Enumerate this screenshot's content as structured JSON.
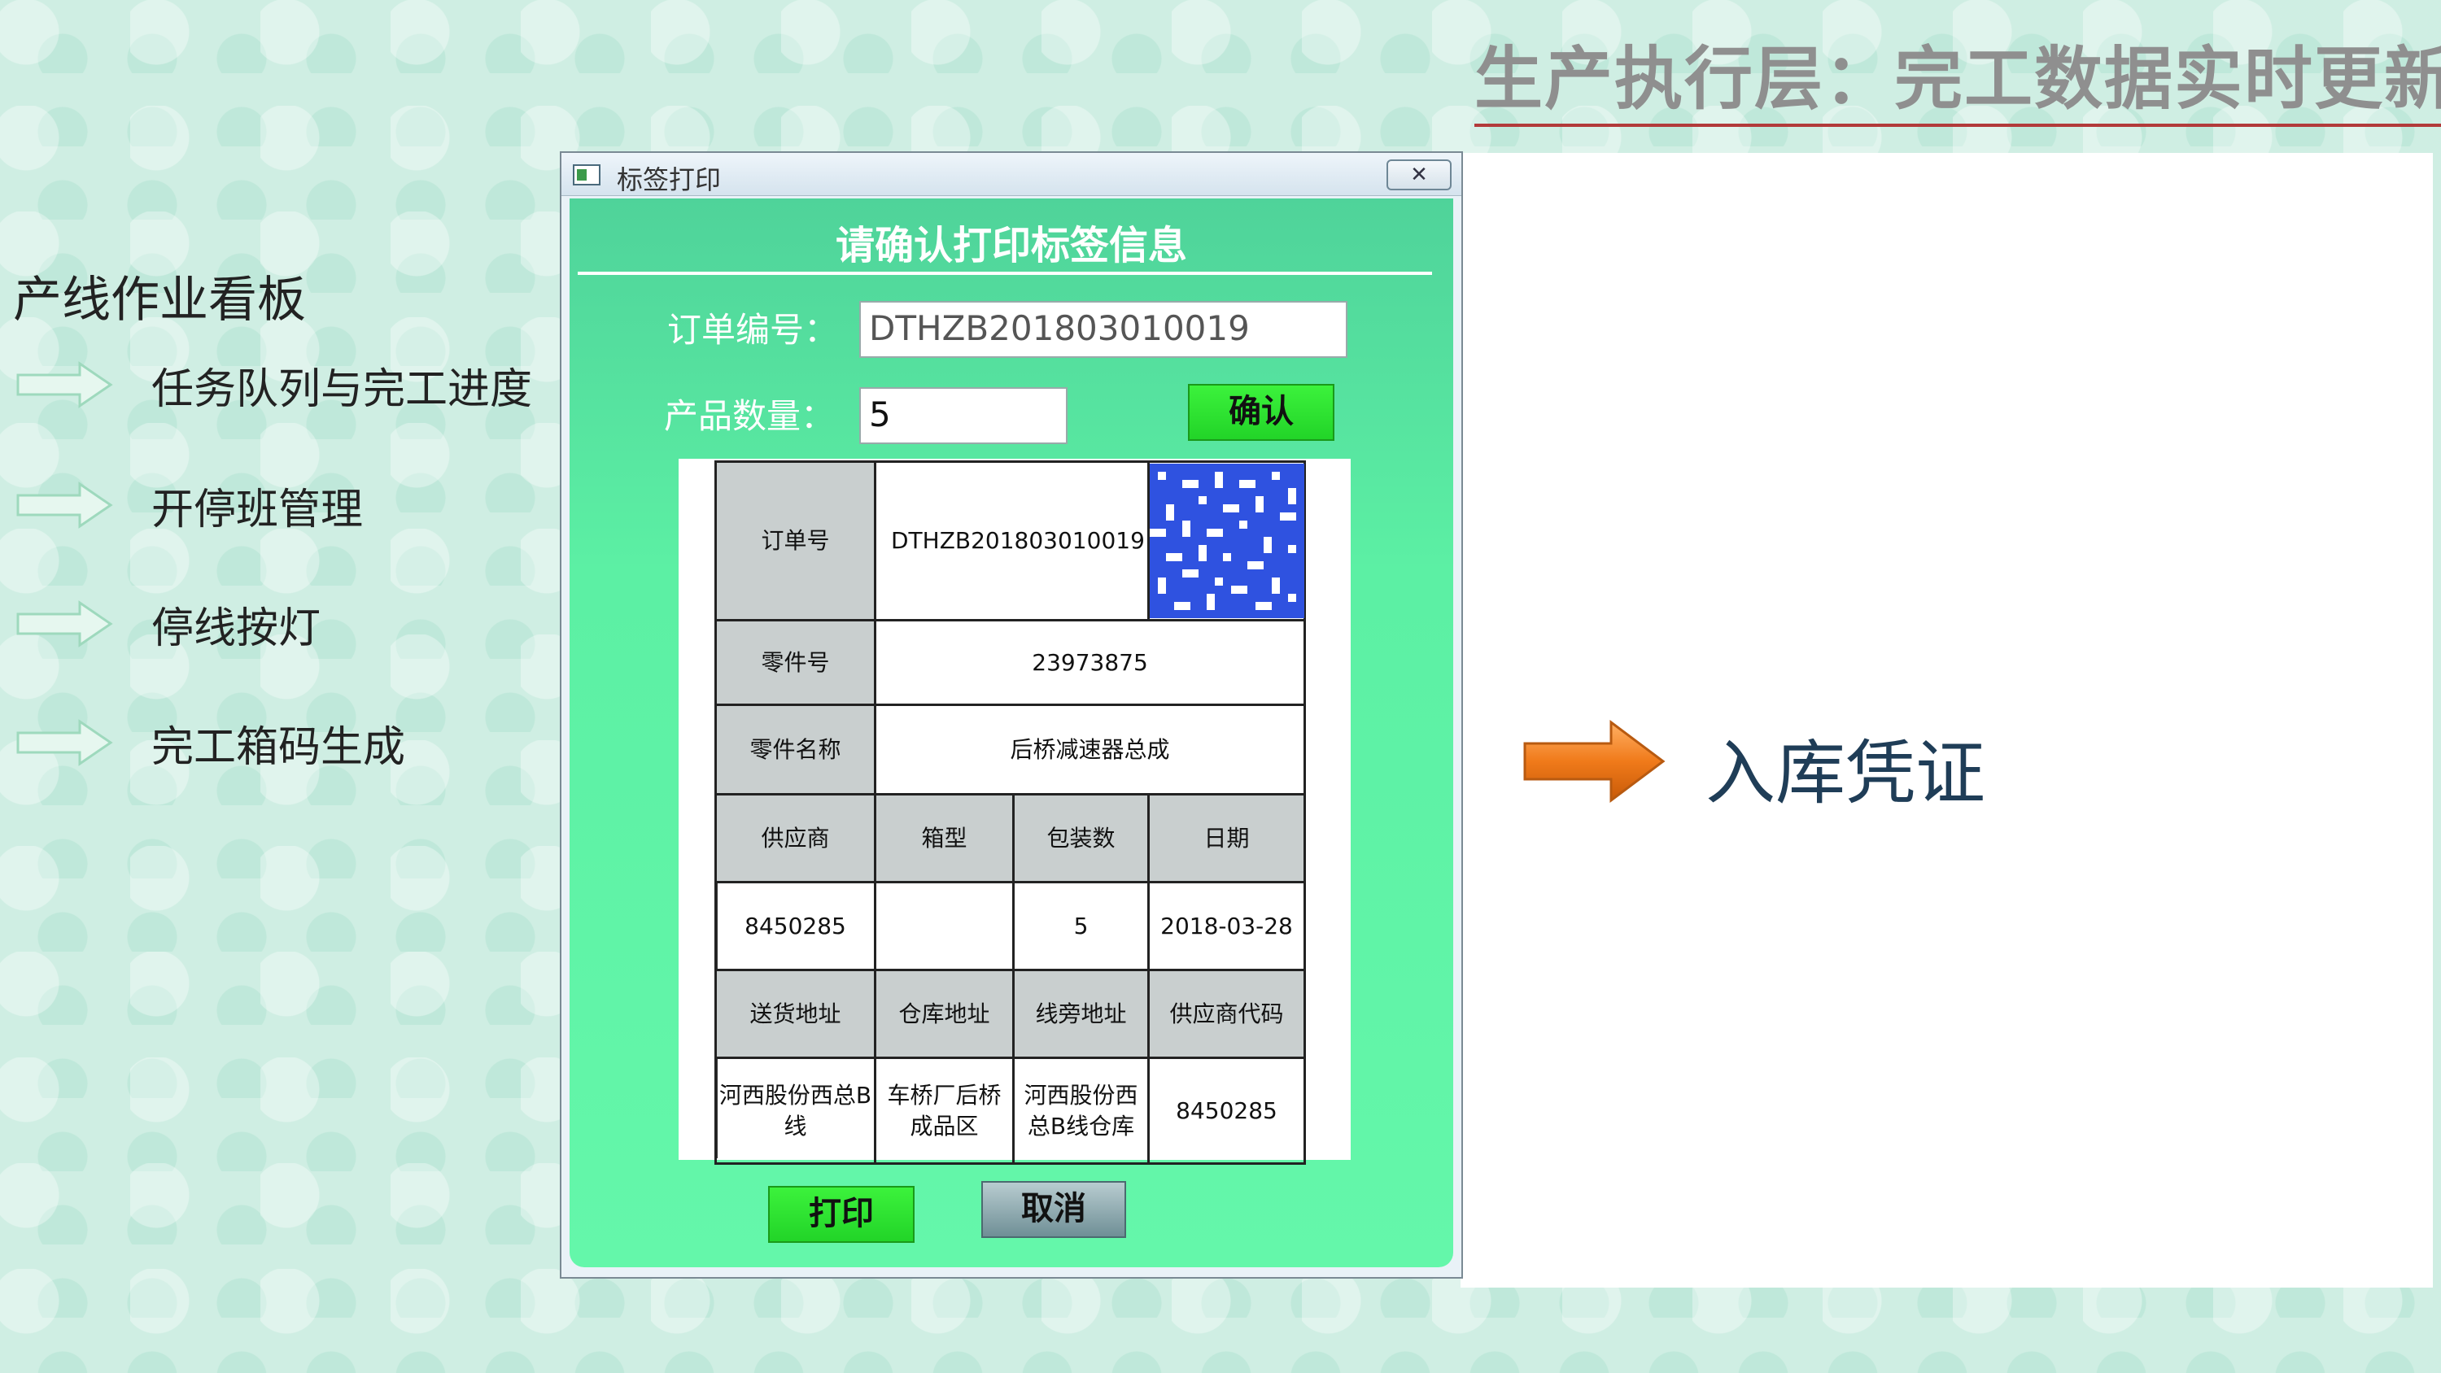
{
  "page": {
    "title": "生产执行层：完工数据实时更新"
  },
  "board": {
    "heading": "产线作业看板",
    "items": [
      {
        "label": "任务队列与完工进度"
      },
      {
        "label": "开停班管理"
      },
      {
        "label": "停线按灯"
      },
      {
        "label": "完工箱码生成"
      }
    ]
  },
  "window": {
    "title": "标签打印",
    "close_glyph": "✕",
    "heading": "请确认打印标签信息",
    "order_no_label": "订单编号：",
    "order_no_value": "DTHZB201803010019",
    "qty_label": "产品数量：",
    "qty_value": "5",
    "confirm_label": "确认",
    "print_label": "打印",
    "cancel_label": "取消"
  },
  "label": {
    "order_label": "订单号",
    "order_value": "DTHZB201803010019",
    "part_no_label": "零件号",
    "part_no_value": "23973875",
    "part_name_label": "零件名称",
    "part_name_value": "后桥减速器总成",
    "headers1": [
      "供应商",
      "箱型",
      "包装数",
      "日期"
    ],
    "values1": [
      "8450285",
      "",
      "5",
      "2018-03-28"
    ],
    "headers2": [
      "送货地址",
      "仓库地址",
      "线旁地址",
      "供应商代码"
    ],
    "values2": [
      "河西股份西总B线",
      "车桥厂后桥成品区",
      "河西股份西总B线仓库",
      "8450285"
    ]
  },
  "callout": {
    "text": "入库凭证"
  },
  "colors": {
    "accent_green": "#22d428",
    "dialog_green": "#5cf0a4",
    "arrow_orange": "#f07a1a",
    "title_gray": "#8f8f8f",
    "rule_red": "#b23a3a"
  }
}
